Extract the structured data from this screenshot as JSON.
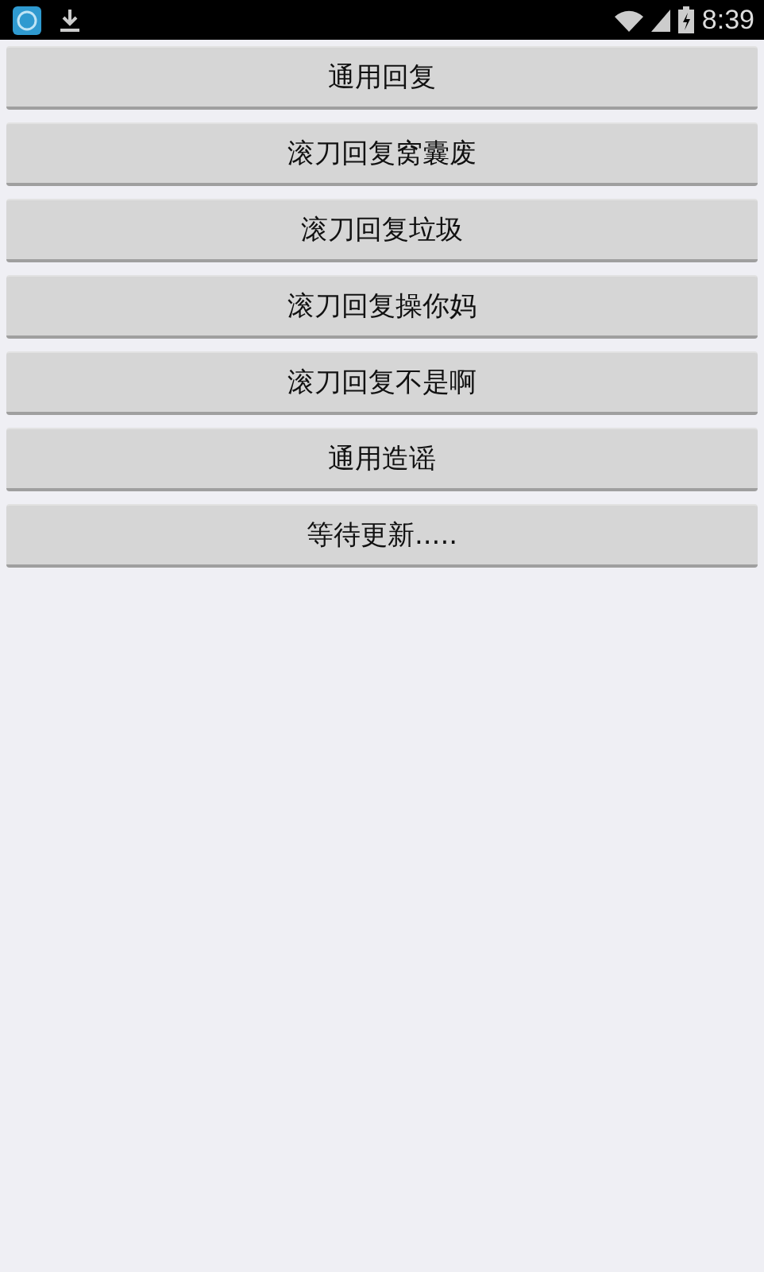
{
  "status_bar": {
    "time": "8:39"
  },
  "buttons": [
    {
      "label": "通用回复"
    },
    {
      "label": "滚刀回复窝囊废"
    },
    {
      "label": "滚刀回复垃圾"
    },
    {
      "label": "滚刀回复操你妈"
    },
    {
      "label": "滚刀回复不是啊"
    },
    {
      "label": "通用造谣"
    },
    {
      "label": "等待更新....."
    }
  ]
}
